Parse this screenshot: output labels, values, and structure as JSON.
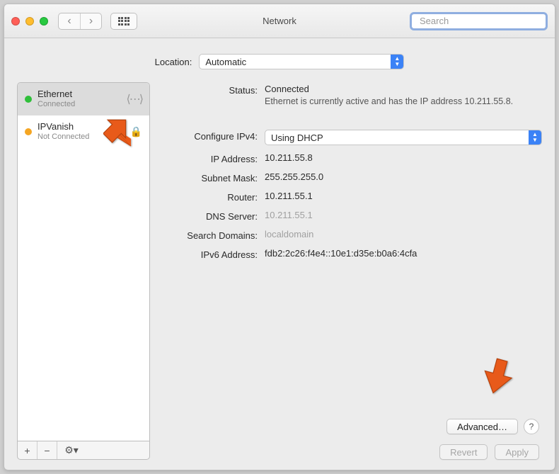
{
  "window": {
    "title": "Network"
  },
  "toolbar": {
    "search_placeholder": "Search"
  },
  "location": {
    "label": "Location:",
    "value": "Automatic"
  },
  "sidebar": {
    "items": [
      {
        "name": "Ethernet",
        "status": "Connected",
        "dot": "green"
      },
      {
        "name": "IPVanish",
        "status": "Not Connected",
        "dot": "orange"
      }
    ],
    "footer": {
      "add": "+",
      "remove": "−",
      "gear": "⚙︎▾"
    }
  },
  "detail": {
    "status_label": "Status:",
    "status_value": "Connected",
    "status_desc": "Ethernet is currently active and has the IP address 10.211.55.8.",
    "rows": {
      "configure_label": "Configure IPv4:",
      "configure_value": "Using DHCP",
      "ip_label": "IP Address:",
      "ip_value": "10.211.55.8",
      "mask_label": "Subnet Mask:",
      "mask_value": "255.255.255.0",
      "router_label": "Router:",
      "router_value": "10.211.55.1",
      "dns_label": "DNS Server:",
      "dns_value": "10.211.55.1",
      "search_label": "Search Domains:",
      "search_value": "localdomain",
      "ipv6_label": "IPv6 Address:",
      "ipv6_value": "fdb2:2c26:f4e4::10e1:d35e:b0a6:4cfa"
    },
    "advanced": "Advanced…",
    "help": "?"
  },
  "buttons": {
    "revert": "Revert",
    "apply": "Apply"
  },
  "colors": {
    "accent": "#3b82f6",
    "arrow": "#e85a1a"
  }
}
